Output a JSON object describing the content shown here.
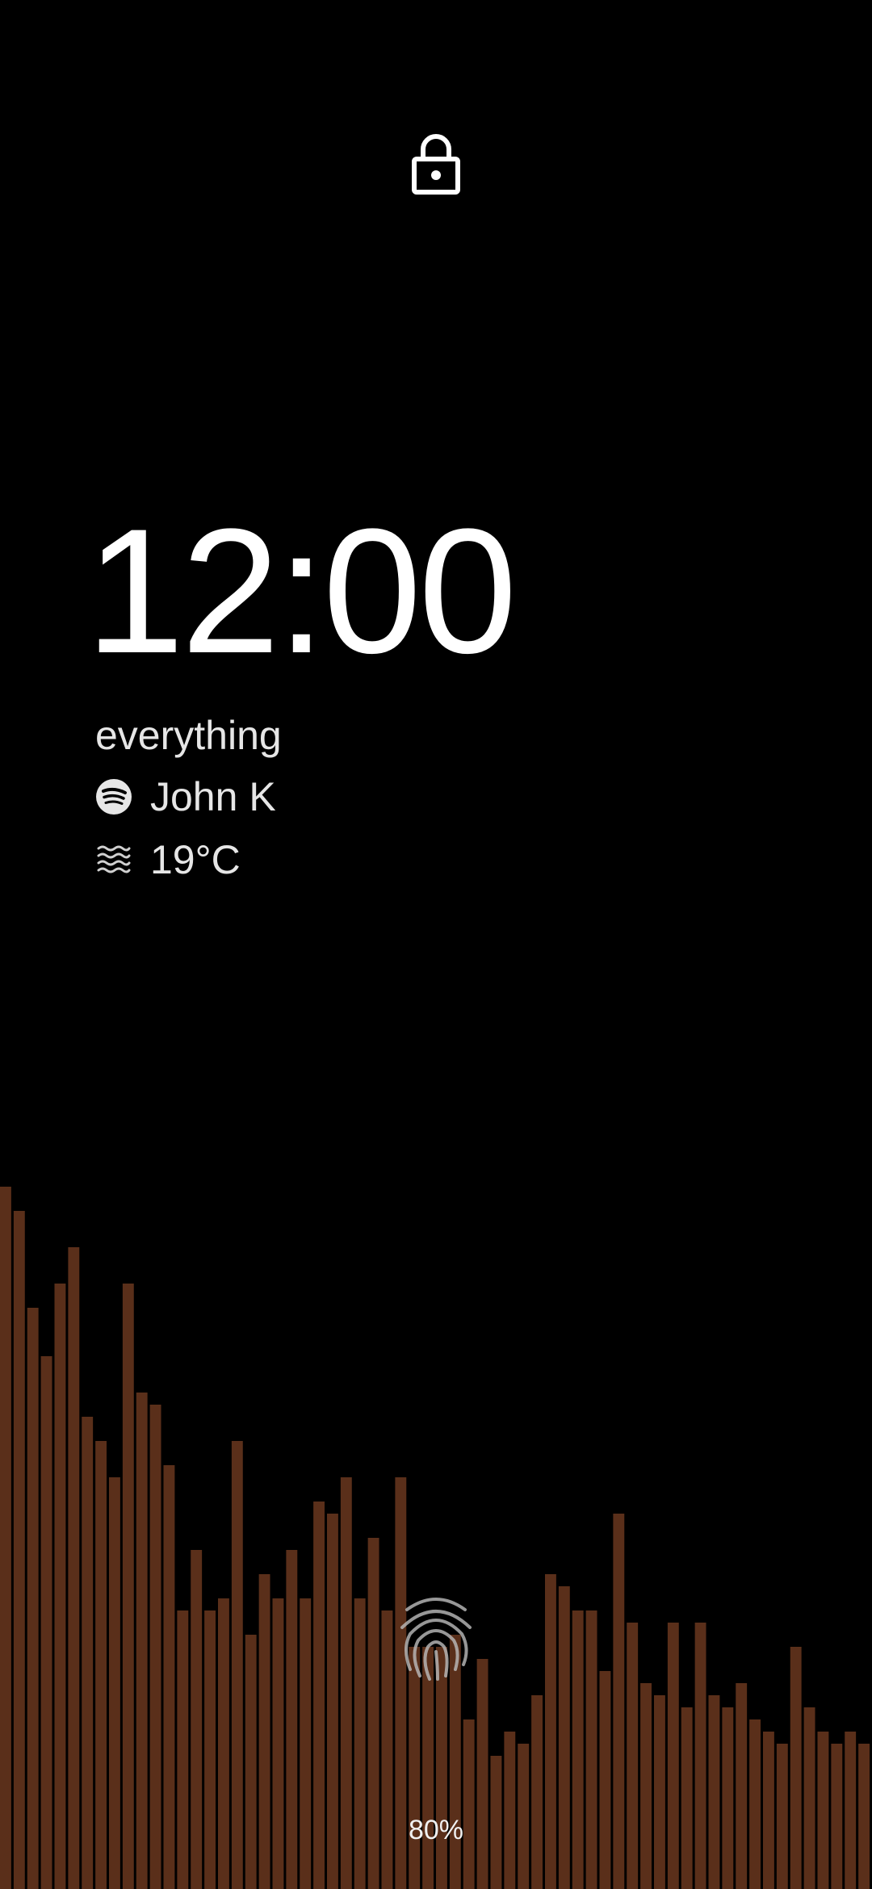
{
  "status": {
    "lock_icon": "lock-icon"
  },
  "clock": {
    "time": "12:00"
  },
  "media": {
    "title": "everything",
    "artist": "John K",
    "app_icon": "spotify-icon"
  },
  "weather": {
    "temperature": "19°C",
    "condition_icon": "haze-icon"
  },
  "visualizer": {
    "color": "#5a2f1a",
    "levels": [
      0.58,
      0.56,
      0.48,
      0.44,
      0.5,
      0.53,
      0.39,
      0.37,
      0.34,
      0.5,
      0.41,
      0.4,
      0.35,
      0.23,
      0.28,
      0.23,
      0.24,
      0.37,
      0.21,
      0.26,
      0.24,
      0.28,
      0.24,
      0.32,
      0.31,
      0.34,
      0.24,
      0.29,
      0.23,
      0.34,
      0.2,
      0.2,
      0.2,
      0.21,
      0.14,
      0.19,
      0.11,
      0.13,
      0.12,
      0.16,
      0.26,
      0.25,
      0.23,
      0.23,
      0.18,
      0.31,
      0.22,
      0.17,
      0.16,
      0.22,
      0.15,
      0.22,
      0.16,
      0.15,
      0.17,
      0.14,
      0.13,
      0.12,
      0.2,
      0.15,
      0.13,
      0.12,
      0.13,
      0.12
    ]
  },
  "unlock": {
    "fingerprint_icon": "fingerprint-icon"
  },
  "battery": {
    "level": "80%"
  }
}
